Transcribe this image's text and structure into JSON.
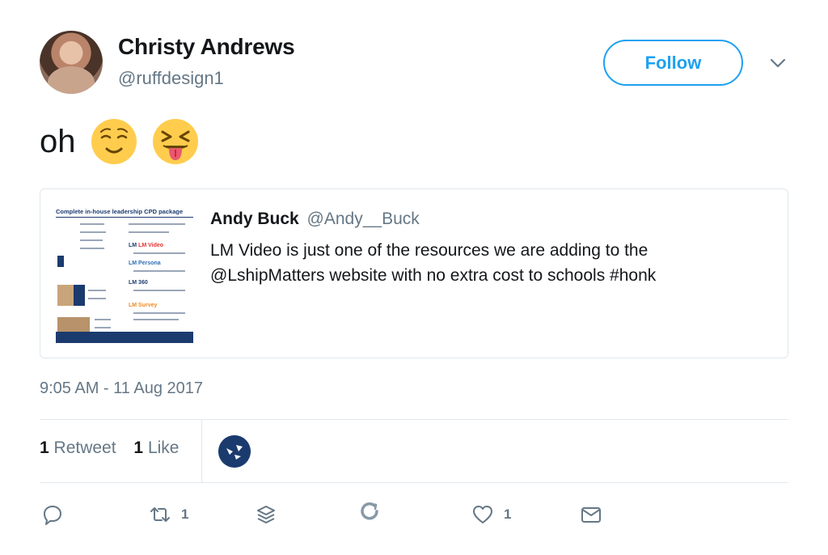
{
  "author": {
    "display_name": "Christy Andrews",
    "username": "@ruffdesign1"
  },
  "follow_label": "Follow",
  "tweet": {
    "text": "oh",
    "emojis": [
      "relieved-face-emoji",
      "squinting-face-with-tongue-emoji"
    ]
  },
  "quoted": {
    "display_name": "Andy Buck",
    "username": "@Andy__Buck",
    "text": "LM Video is just one of the resources we are adding to the @LshipMatters website with no extra cost to schools #honk",
    "thumbnail": {
      "title": "Complete in-house leadership CPD package",
      "labels": [
        "LM Video",
        "LM Persona",
        "LM 360",
        "LM Survey"
      ]
    }
  },
  "timestamp": "9:05 AM - 11 Aug 2017",
  "stats": {
    "retweet_count": "1",
    "retweet_label": "Retweet",
    "like_count": "1",
    "like_label": "Like"
  },
  "actions": {
    "retweet_count": "1",
    "like_count": "1"
  },
  "icons": [
    "chevron-down-icon",
    "reply-icon",
    "retweet-icon",
    "stack-icon",
    "refresh-icon",
    "heart-icon",
    "message-icon"
  ],
  "colors": {
    "accent": "#1da1f2",
    "secondary_text": "#657786",
    "divider": "#e1e8ed"
  }
}
